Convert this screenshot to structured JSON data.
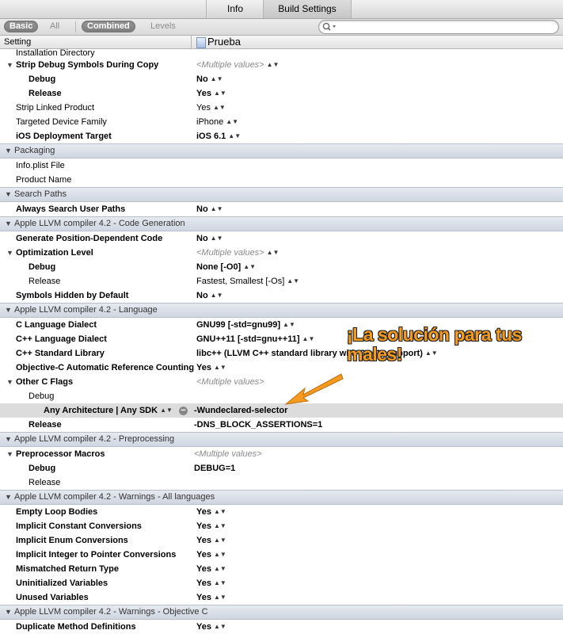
{
  "tabs": {
    "info": "Info",
    "build_settings": "Build Settings"
  },
  "filters": {
    "basic": "Basic",
    "all": "All",
    "combined": "Combined",
    "levels": "Levels"
  },
  "columns": {
    "setting": "Setting",
    "project": "Prueba"
  },
  "rows": {
    "installation_directory": {
      "label": "Installation Directory"
    },
    "strip_debug": {
      "label": "Strip Debug Symbols During Copy",
      "value": "<Multiple values>"
    },
    "strip_debug_debug": {
      "label": "Debug",
      "value": "No"
    },
    "strip_debug_release": {
      "label": "Release",
      "value": "Yes"
    },
    "strip_linked": {
      "label": "Strip Linked Product",
      "value": "Yes"
    },
    "targeted_device": {
      "label": "Targeted Device Family",
      "value": "iPhone"
    },
    "ios_target": {
      "label": "iOS Deployment Target",
      "value": "iOS 6.1"
    },
    "sec_packaging": {
      "label": "Packaging"
    },
    "infoplist": {
      "label": "Info.plist File"
    },
    "product_name": {
      "label": "Product Name"
    },
    "sec_search_paths": {
      "label": "Search Paths"
    },
    "always_search": {
      "label": "Always Search User Paths",
      "value": "No"
    },
    "sec_codegen": {
      "label": "Apple LLVM compiler 4.2 - Code Generation"
    },
    "gen_pos_dep": {
      "label": "Generate Position-Dependent Code",
      "value": "No"
    },
    "opt_level": {
      "label": "Optimization Level",
      "value": "<Multiple values>"
    },
    "opt_debug": {
      "label": "Debug",
      "value": "None [-O0]"
    },
    "opt_release": {
      "label": "Release",
      "value": "Fastest, Smallest [-Os]"
    },
    "symbols_hidden": {
      "label": "Symbols Hidden by Default",
      "value": "No"
    },
    "sec_language": {
      "label": "Apple LLVM compiler 4.2 - Language"
    },
    "c_dialect": {
      "label": "C Language Dialect",
      "value": "GNU99 [-std=gnu99]"
    },
    "cpp_dialect": {
      "label": "C++ Language Dialect",
      "value": "GNU++11 [-std=gnu++11]"
    },
    "cpp_stdlib": {
      "label": "C++ Standard Library",
      "value": "libc++ (LLVM C++ standard library with C++11 support)"
    },
    "objc_arc": {
      "label": "Objective-C Automatic Reference Counting",
      "value": "Yes"
    },
    "other_c_flags": {
      "label": "Other C Flags",
      "value": "<Multiple values>"
    },
    "ocf_debug": {
      "label": "Debug"
    },
    "ocf_any_arch": {
      "label": "Any Architecture | Any SDK",
      "value": "-Wundeclared-selector"
    },
    "ocf_release": {
      "label": "Release",
      "value": "-DNS_BLOCK_ASSERTIONS=1"
    },
    "sec_preprocessing": {
      "label": "Apple LLVM compiler 4.2 - Preprocessing"
    },
    "preproc_macros": {
      "label": "Preprocessor Macros",
      "value": "<Multiple values>"
    },
    "pm_debug": {
      "label": "Debug",
      "value": "DEBUG=1"
    },
    "pm_release": {
      "label": "Release"
    },
    "sec_warnings_all": {
      "label": "Apple LLVM compiler 4.2 - Warnings - All languages"
    },
    "empty_loop": {
      "label": "Empty Loop Bodies",
      "value": "Yes"
    },
    "implicit_const": {
      "label": "Implicit Constant Conversions",
      "value": "Yes"
    },
    "implicit_enum": {
      "label": "Implicit Enum Conversions",
      "value": "Yes"
    },
    "implicit_int_ptr": {
      "label": "Implicit Integer to Pointer Conversions",
      "value": "Yes"
    },
    "mismatched_return": {
      "label": "Mismatched Return Type",
      "value": "Yes"
    },
    "uninit_vars": {
      "label": "Uninitialized Variables",
      "value": "Yes"
    },
    "unused_vars": {
      "label": "Unused Variables",
      "value": "Yes"
    },
    "sec_warnings_objc": {
      "label": "Apple LLVM compiler 4.2 - Warnings - Objective C"
    },
    "dup_method": {
      "label": "Duplicate Method Definitions",
      "value": "Yes"
    }
  },
  "annotation": {
    "line1": "¡La solución para tus",
    "line2": "males!"
  },
  "icons": {
    "search": "magnifier-icon",
    "stepper": "up-down-stepper-icon",
    "disclosure": "disclosure-triangle-icon",
    "remove": "minus-circle-icon",
    "arrow": "orange-arrow-icon"
  },
  "colors": {
    "annotation": "#f39a1f",
    "section_bg": "#dbe0e8",
    "highlight_row": "#dcdcdc"
  }
}
